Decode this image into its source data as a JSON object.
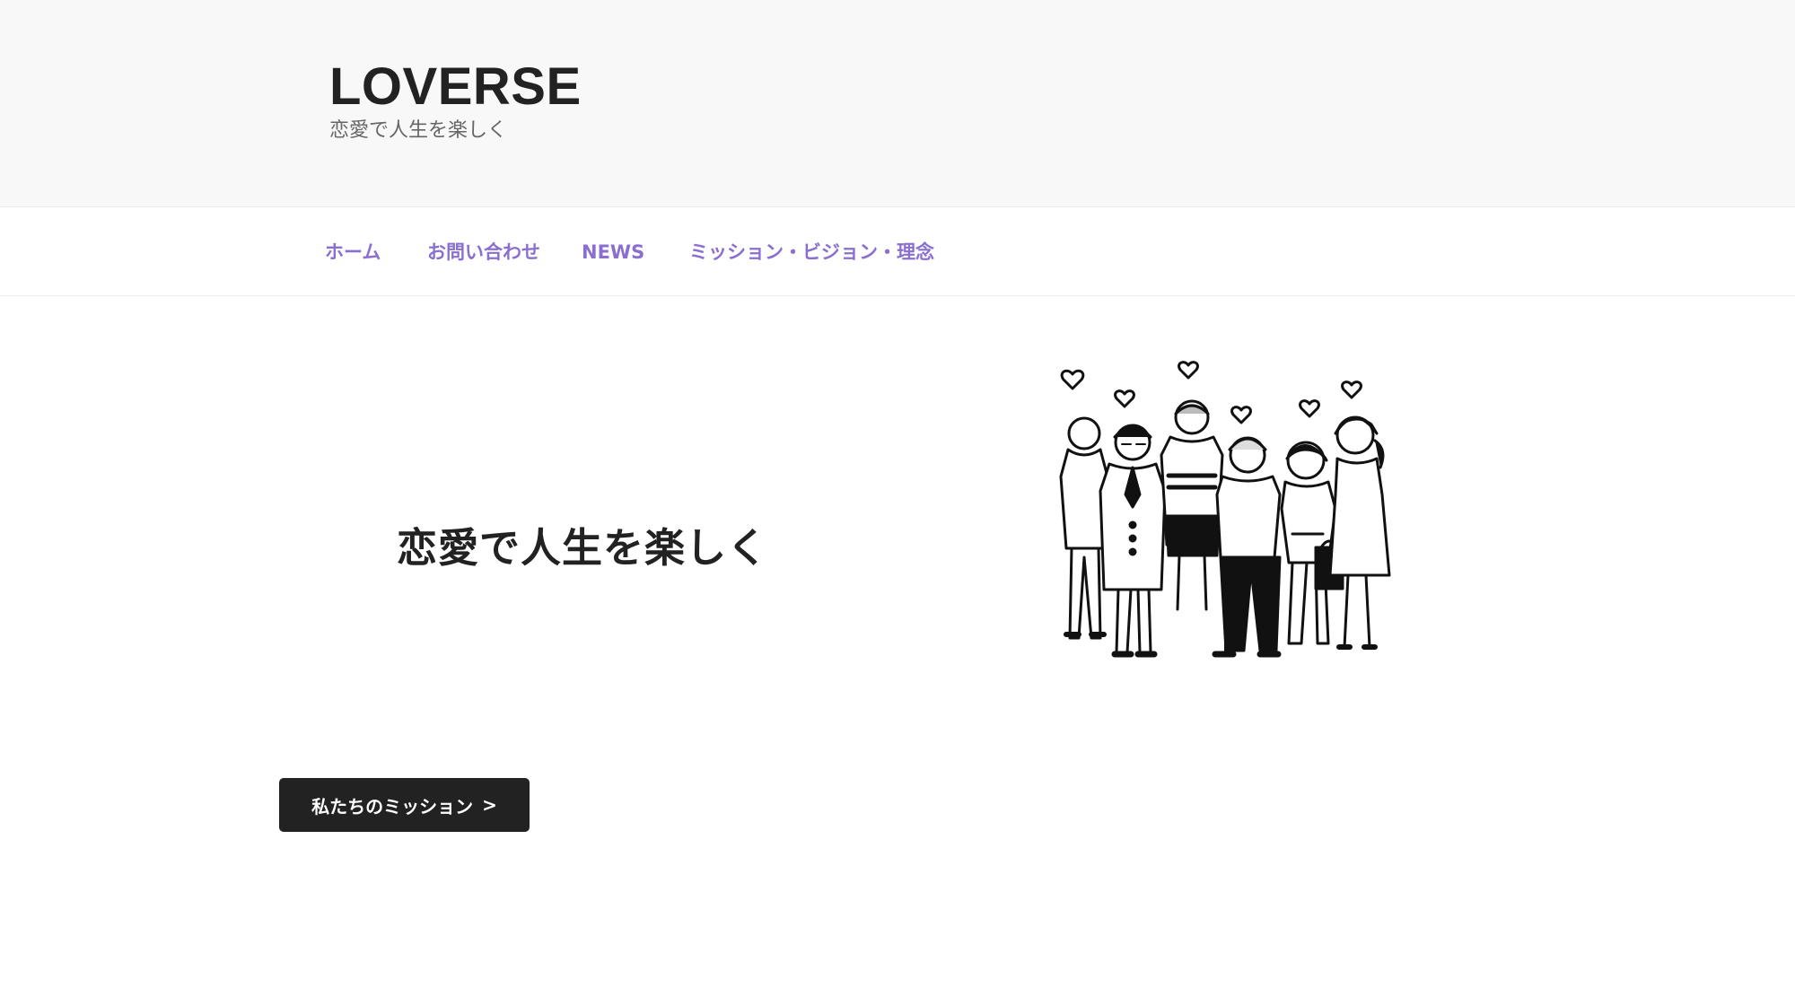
{
  "header": {
    "site_title": "LOVERSE",
    "tagline": "恋愛で人生を楽しく"
  },
  "nav": {
    "items": [
      {
        "label": "ホーム"
      },
      {
        "label": "お問い合わせ"
      },
      {
        "label": "NEWS"
      },
      {
        "label": "ミッション・ビジョン・理念"
      }
    ]
  },
  "hero": {
    "heading": "恋愛で人生を楽しく",
    "cta_label": "私たちのミッション",
    "cta_icon": "chevron-right-icon",
    "illustration": "group-of-people-with-hearts"
  },
  "colors": {
    "nav_link": "#8b6fd0",
    "header_bg": "#f8f8f8",
    "button_bg": "#222222",
    "text_dark": "#222222"
  }
}
